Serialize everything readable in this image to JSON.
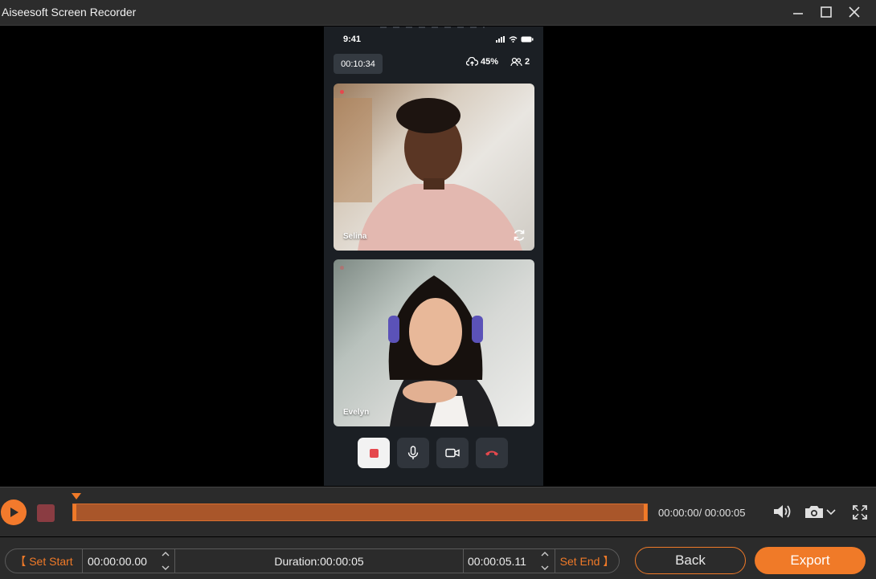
{
  "window": {
    "title": "Aiseesoft Screen Recorder"
  },
  "phone": {
    "clock": "9:41",
    "call_timer": "00:10:34",
    "upload_percent": "45%",
    "participant_count": "2",
    "participants": [
      {
        "name": "Selina"
      },
      {
        "name": "Evelyn"
      }
    ],
    "colors": {
      "record_red": "#e5484d",
      "end_call_red": "#e5484d"
    }
  },
  "player": {
    "time_readout": "00:00:00/ 00:00:05",
    "accent": "#f07a28"
  },
  "trim": {
    "set_start_label": "【 Set Start",
    "start_time": "00:00:00.00",
    "duration_label": "Duration:00:00:05",
    "end_time": "00:00:05.11",
    "set_end_label": "Set End 】"
  },
  "actions": {
    "back_label": "Back",
    "export_label": "Export"
  }
}
